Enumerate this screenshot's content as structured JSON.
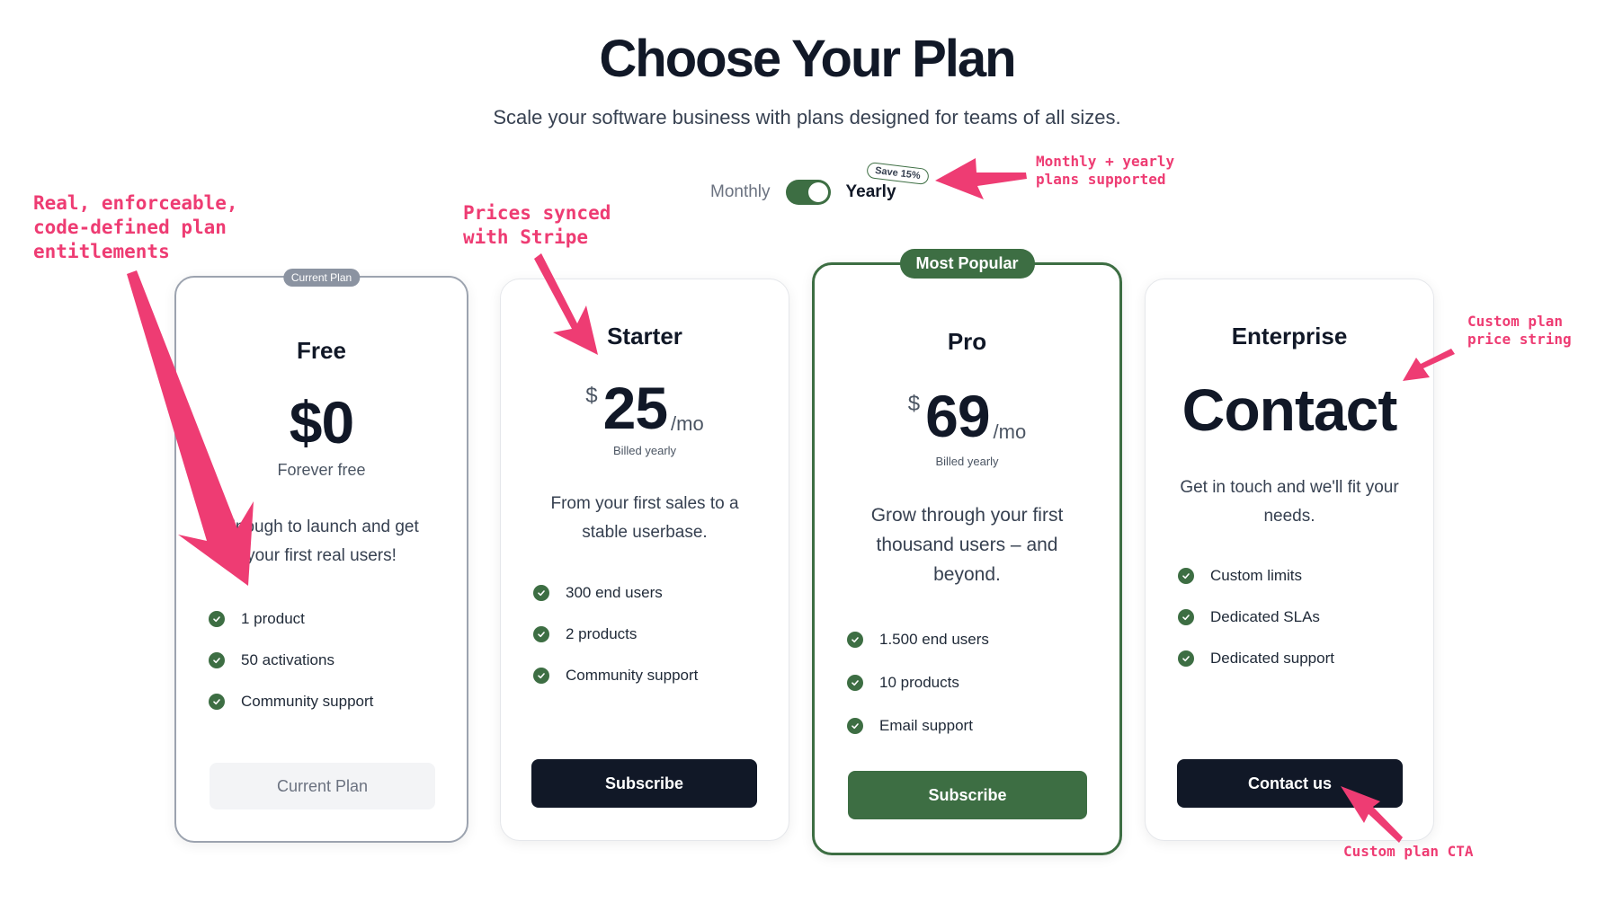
{
  "header": {
    "title": "Choose Your Plan",
    "subtitle": "Scale your software business with plans designed for teams of all sizes."
  },
  "billing": {
    "monthly_label": "Monthly",
    "yearly_label": "Yearly",
    "selected": "Yearly",
    "save_badge": "Save 15%"
  },
  "plans": [
    {
      "name": "Free",
      "tag": "Current Plan",
      "price": "$0",
      "price_note": "Forever free",
      "description": "Enough to launch and get your first real users!",
      "features": [
        "1 product",
        "50 activations",
        "Community support"
      ],
      "cta": "Current Plan"
    },
    {
      "name": "Starter",
      "currency": "$",
      "amount": "25",
      "period": "/mo",
      "price_note": "Billed yearly",
      "description": "From your first sales to a stable userbase.",
      "features": [
        "300 end users",
        "2 products",
        "Community support"
      ],
      "cta": "Subscribe"
    },
    {
      "name": "Pro",
      "tag": "Most Popular",
      "currency": "$",
      "amount": "69",
      "period": "/mo",
      "price_note": "Billed yearly",
      "description": "Grow through your first thousand users – and beyond.",
      "features": [
        "1.500 end users",
        "10 products",
        "Email support"
      ],
      "cta": "Subscribe"
    },
    {
      "name": "Enterprise",
      "price": "Contact",
      "description": "Get in touch and we'll fit your needs.",
      "features": [
        "Custom limits",
        "Dedicated SLAs",
        "Dedicated support"
      ],
      "cta": "Contact us"
    }
  ],
  "annotations": {
    "entitlements": "Real, enforceable,\ncode-defined plan\nentitlements",
    "stripe": "Prices synced\nwith Stripe",
    "billing_modes": "Monthly + yearly\nplans supported",
    "custom_price": "Custom plan\nprice string",
    "custom_cta": "Custom plan CTA"
  },
  "colors": {
    "brand_green": "#3d6e43",
    "dark": "#111827",
    "annotation": "#ee3c73"
  }
}
